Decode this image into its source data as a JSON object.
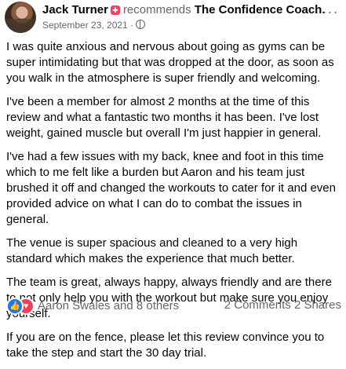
{
  "header": {
    "author": "Jack Turner",
    "verb": "recommends",
    "page": "The Confidence Coach.",
    "date": "September 23, 2021",
    "separator": "·",
    "more_icon": "more-horizontal-icon",
    "privacy_icon": "globe-icon",
    "badge_icon": "recommend-badge-icon"
  },
  "review": {
    "paragraphs": [
      "I was quite anxious and nervous about going as gyms can be super intimidating but that was dropped at the door, as soon as you walk in the atmosphere is super friendly and welcoming.",
      "I've been a member for almost 2 months at the time of this review and what a fantastic two months it has been. I've lost weight, gained muscle but overall I'm just happier in general.",
      "I've had a few issues with my back, knee and foot in this time which to me felt like a burden but Aaron and his team just brushed it off and changed the workouts to cater for it and even provided advice on what I can do to combat the issues in general.",
      "The venue is super spacious and cleaned to a very high standard which makes the experience that much better.",
      "The team is great, always happy, always friendly and are there to not only help you with the workout but make sure you enjoy yourself.",
      "If you are on the fence, please let this review convince you to take the step and start the 30 day trial."
    ]
  },
  "footer": {
    "reactions_text": "Aaron Swales and 8 others",
    "reaction_icons": [
      "like-icon",
      "love-icon"
    ],
    "comments": "2 Comments",
    "shares": "2 Shares"
  },
  "colors": {
    "text": "#050505",
    "secondary": "#65676b",
    "like_blue": "#1877f2",
    "love_red": "#f33e58",
    "badge_red": "#f3425f"
  }
}
